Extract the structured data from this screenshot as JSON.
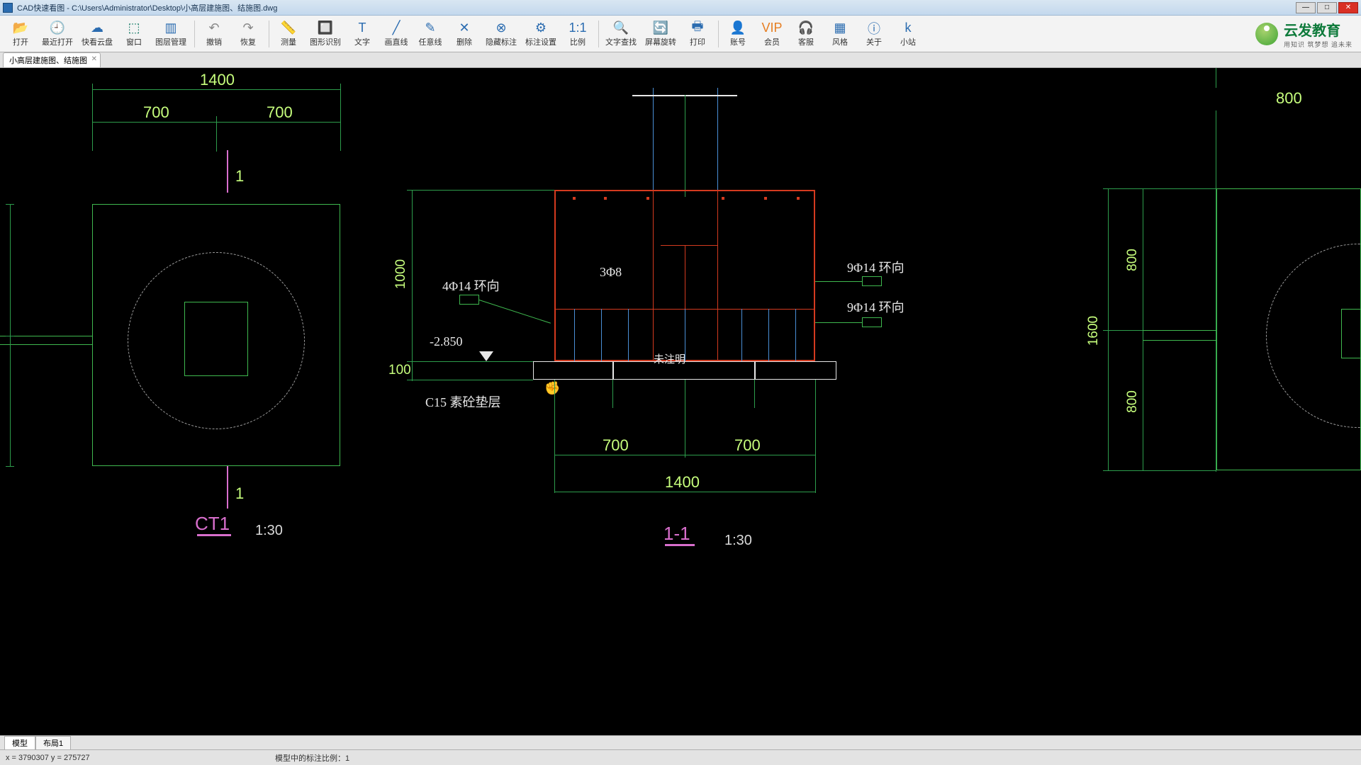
{
  "app": {
    "title": "CAD快速看图 - C:\\Users\\Administrator\\Desktop\\小高层建施图、结施图.dwg"
  },
  "tools": [
    {
      "id": "open",
      "label": "打开",
      "glyph": "📂"
    },
    {
      "id": "recent",
      "label": "最近打开",
      "glyph": "🕘"
    },
    {
      "id": "cloud",
      "label": "快看云盘",
      "glyph": "☁"
    },
    {
      "id": "window",
      "label": "窗口",
      "glyph": "⬚",
      "cls": "teal"
    },
    {
      "id": "layer",
      "label": "图层管理",
      "glyph": "▥"
    },
    {
      "id": "undo",
      "label": "撤销",
      "glyph": "↶",
      "cls": "gray"
    },
    {
      "id": "redo",
      "label": "恢复",
      "glyph": "↷",
      "cls": "gray"
    },
    {
      "id": "measure",
      "label": "测量",
      "glyph": "📏"
    },
    {
      "id": "recog",
      "label": "图形识别",
      "glyph": "🔲"
    },
    {
      "id": "text",
      "label": "文字",
      "glyph": "T"
    },
    {
      "id": "line",
      "label": "画直线",
      "glyph": "╱"
    },
    {
      "id": "anyline",
      "label": "任意线",
      "glyph": "✎"
    },
    {
      "id": "delete",
      "label": "删除",
      "glyph": "✕"
    },
    {
      "id": "hidedim",
      "label": "隐藏标注",
      "glyph": "⊗"
    },
    {
      "id": "dimcfg",
      "label": "标注设置",
      "glyph": "⚙"
    },
    {
      "id": "ratio",
      "label": "比例",
      "glyph": "1:1"
    },
    {
      "id": "textsearch",
      "label": "文字查找",
      "glyph": "🔍"
    },
    {
      "id": "rotate",
      "label": "屏幕旋转",
      "glyph": "🔄"
    },
    {
      "id": "print",
      "label": "打印",
      "glyph": "🖶"
    },
    {
      "id": "account",
      "label": "账号",
      "glyph": "👤"
    },
    {
      "id": "vip",
      "label": "会员",
      "glyph": "VIP",
      "cls": "orange"
    },
    {
      "id": "service",
      "label": "客服",
      "glyph": "🎧"
    },
    {
      "id": "style",
      "label": "风格",
      "glyph": "▦"
    },
    {
      "id": "about",
      "label": "关于",
      "glyph": "ⓘ"
    },
    {
      "id": "keyboard",
      "label": "小站",
      "glyph": "k"
    }
  ],
  "brand": {
    "main": "云发教育",
    "sub": "用知识 筑梦想 追未来"
  },
  "file_tabs": [
    {
      "label": "小高层建施图、结施图"
    }
  ],
  "layout_tabs": {
    "model": "模型",
    "layout1": "布局1"
  },
  "status": {
    "coords": "x = 3790307   y = 275727",
    "dimscale": "模型中的标注比例：1"
  },
  "drawing": {
    "left": {
      "dim_top": "1400",
      "dim_l": "700",
      "dim_r": "700",
      "sec": "1",
      "title": "CT1",
      "scale": "1:30"
    },
    "mid": {
      "dim_h": "1000",
      "dim_100": "100",
      "r1": "4Φ14 环向",
      "r2": "3Φ8",
      "r3": "9Φ14 环向",
      "r4": "9Φ14 环向",
      "elev": "-2.850",
      "cushion": "C15 素砼垫层",
      "note": "未注明",
      "dim_b_l": "700",
      "dim_b_r": "700",
      "dim_b": "1400",
      "title": "1-1",
      "scale": "1:30"
    },
    "right": {
      "dim_top": "800",
      "dim_t": "800",
      "dim_h": "1600",
      "dim_b": "800"
    }
  }
}
